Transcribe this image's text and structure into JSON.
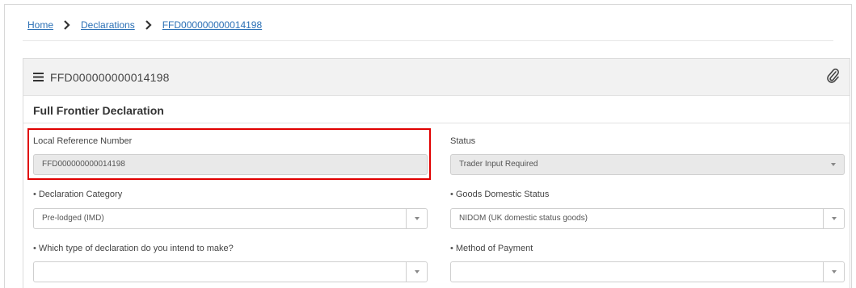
{
  "breadcrumb": {
    "home": "Home",
    "declarations": "Declarations",
    "current": "FFD000000000014198"
  },
  "panel": {
    "title": "FFD000000000014198",
    "section_title": "Full Frontier Declaration"
  },
  "form": {
    "lrn": {
      "label": "Local Reference Number",
      "value": "FFD000000000014198"
    },
    "status": {
      "label": "Status",
      "value": "Trader Input Required"
    },
    "declaration_category": {
      "label": "Declaration Category",
      "value": "Pre-lodged (IMD)",
      "required_mark": "•"
    },
    "goods_domestic_status": {
      "label": "Goods Domestic Status",
      "value": "NIDOM (UK domestic status goods)",
      "required_mark": "•"
    },
    "declaration_type": {
      "label": "Which type of declaration do you intend to make?",
      "value": "",
      "required_mark": "•"
    },
    "method_of_payment": {
      "label": "Method of Payment",
      "value": "",
      "required_mark": "•"
    }
  },
  "colors": {
    "link": "#2a6fb5",
    "highlight": "#e00000",
    "readonly_bg": "#e9e9e9",
    "header_bg": "#f2f2f2"
  },
  "icons": [
    "chevron-right-icon",
    "menu-icon",
    "paperclip-icon",
    "caret-down-icon"
  ]
}
